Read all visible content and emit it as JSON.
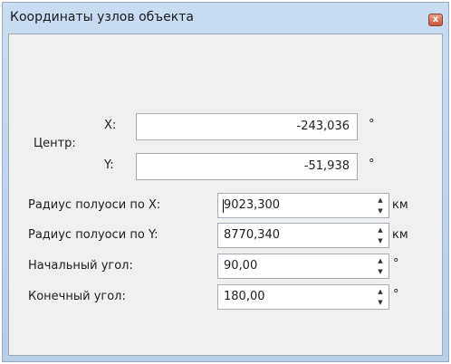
{
  "window": {
    "title": "Координаты узлов объекта",
    "close_label": "x"
  },
  "center": {
    "label": "Центр:",
    "x_label": "X:",
    "x_value": "-243,036",
    "y_label": "Y:",
    "y_value": "-51,938",
    "unit": "°"
  },
  "fields": [
    {
      "label": "Радиус полуоси по X:",
      "value": "9023,300",
      "unit": "км"
    },
    {
      "label": "Радиус полуоси по Y:",
      "value": "8770,340",
      "unit": "км"
    },
    {
      "label": "Начальный угол:",
      "value": "90,00",
      "unit": "°"
    },
    {
      "label": "Конечный угол:",
      "value": "180,00",
      "unit": "°"
    }
  ],
  "icons": {
    "spin_up": "spin-up-arrow-icon",
    "spin_down": "spin-down-arrow-icon"
  }
}
